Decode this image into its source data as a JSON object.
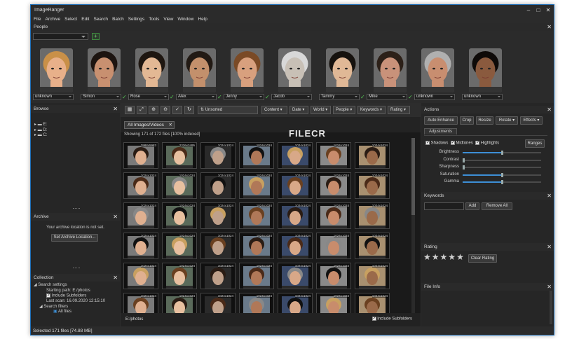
{
  "window": {
    "title": "ImageRanger",
    "controls": [
      "–",
      "□",
      "✕"
    ]
  },
  "menu": [
    "File",
    "Archive",
    "Select",
    "Edit",
    "Search",
    "Batch",
    "Settings",
    "Tools",
    "View",
    "Window",
    "Help"
  ],
  "people": {
    "title": "People",
    "add_icon": "plus-icon",
    "persons": [
      {
        "name": "unknown",
        "checked": false,
        "skin": "#e8b08a",
        "hair": "#c99048"
      },
      {
        "name": "Simon",
        "checked": true,
        "skin": "#c89070",
        "hair": "#1c1410"
      },
      {
        "name": "Rose",
        "checked": true,
        "skin": "#e3b894",
        "hair": "#1e1610"
      },
      {
        "name": "Alex",
        "checked": true,
        "skin": "#c3906c",
        "hair": "#221a14"
      },
      {
        "name": "Jenny",
        "checked": true,
        "skin": "#d8a07e",
        "hair": "#7a4a26"
      },
      {
        "name": "Jacob",
        "checked": false,
        "skin": "#c8c0b6",
        "hair": "#d8d8d8"
      },
      {
        "name": "Tammy",
        "checked": true,
        "skin": "#e0b896",
        "hair": "#16120e"
      },
      {
        "name": "Mike",
        "checked": true,
        "skin": "#c9927a",
        "hair": "#2c2018"
      },
      {
        "name": "unknown",
        "checked": false,
        "skin": "#c88e70",
        "hair": "#b0b0b0"
      },
      {
        "name": "unknown",
        "checked": false,
        "skin": "#8a5a3e",
        "hair": "#0e0a08"
      }
    ]
  },
  "browse": {
    "title": "Browse",
    "drives": [
      "E:",
      "D:",
      "C:"
    ]
  },
  "archive": {
    "title": "Archive",
    "message": "Your archive location is not set.",
    "button": "Set Archive Location..."
  },
  "collection": {
    "title": "Collection",
    "search_settings": "Search settings",
    "starting_path": "Starting path: E:/photos",
    "include_subfolders": "Include Subfolders",
    "last_scan": "Last scan: 16.09.2020 12:15:10",
    "search_filters": "Search filters",
    "all_files": "All files"
  },
  "toolbar": {
    "sort": "Unsorted",
    "filters": [
      "Content",
      "Date",
      "World",
      "People",
      "Keywords",
      "Rating"
    ]
  },
  "tab": {
    "label": "All Images/Videos",
    "summary": "Showing 171 of 172 files [100% indexed]"
  },
  "watermark": "FILECR",
  "grid": {
    "resolutions": [
      "3988x5983",
      "2326x3495",
      "1024x1024",
      "1024x1024",
      "1024x1024",
      "1024x1024",
      "1024x1024",
      "1024x1024",
      "1024x1024",
      "1024x1024",
      "1024x1024",
      "1024x1024",
      "1024x1024",
      "1024x1024",
      "1024x1024",
      "1024x1024",
      "1024x1024",
      "1024x1024",
      "1024x1024",
      "1024x1024",
      "1024x1024",
      "1024x1024",
      "1024x1024",
      "1024x1024",
      "1024x1024",
      "1024x1024",
      "1024x1024",
      "1024x1024",
      "1024x1024",
      "1024x1024",
      "1024x1024",
      "1024x1024",
      "1024x1024",
      "1024x1024",
      "1024x1024",
      "1024x1024",
      "1024x1024",
      "1024x1024",
      "1024x1024",
      "1024x1024",
      "1024x1024",
      "1024x1024"
    ],
    "path": "E:/photos",
    "include_subfolders": "Include Subfolders"
  },
  "actions": {
    "title": "Actions",
    "buttons": [
      "Auto Enhance",
      "Crop",
      "Resize",
      "Rotate",
      "Effects"
    ],
    "adjustments_tab": "Adjustments",
    "toggles": [
      "Shadows",
      "Midtones",
      "Highlights"
    ],
    "ranges_button": "Ranges",
    "sliders": [
      {
        "label": "Brightness",
        "value": 0.5
      },
      {
        "label": "Contrast",
        "value": 0.0
      },
      {
        "label": "Sharpness",
        "value": 0.0
      },
      {
        "label": "Saturation",
        "value": 0.5
      },
      {
        "label": "Gamma",
        "value": 0.5
      }
    ]
  },
  "keywords": {
    "title": "Keywords",
    "add": "Add",
    "remove_all": "Remove All"
  },
  "rating": {
    "title": "Rating",
    "stars": 5,
    "clear": "Clear Rating"
  },
  "fileinfo": {
    "title": "File Info"
  },
  "status": "Selected 171 files [74.88 MB]",
  "colors": {
    "accent": "#3d8fd6",
    "check": "#52c252",
    "frame": "#1f6fb8"
  }
}
